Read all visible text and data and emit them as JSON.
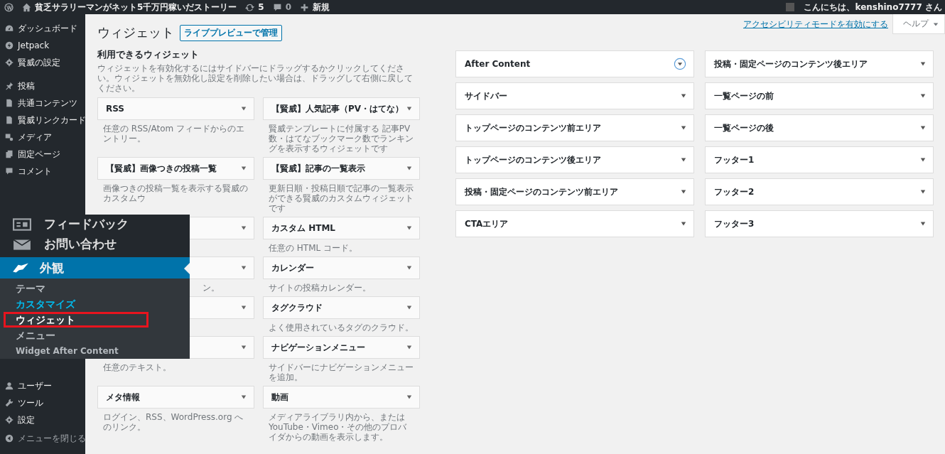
{
  "admin_bar": {
    "site_name": "貧乏サラリーマンがネット5千万円稼いだストーリー",
    "updates": "5",
    "comments": "0",
    "new": "新規",
    "greeting": "こんにちは、kenshino7777 さん"
  },
  "sidebar": {
    "groups": [
      [
        {
          "label": "ダッシュボード"
        },
        {
          "label": "Jetpack"
        },
        {
          "label": "賢威の設定"
        }
      ],
      [
        {
          "label": "投稿"
        },
        {
          "label": "共通コンテンツ"
        },
        {
          "label": "賢威リンクカード"
        },
        {
          "label": "メディア"
        },
        {
          "label": "固定ページ"
        },
        {
          "label": "コメント"
        }
      ]
    ],
    "bottom_items": [
      {
        "label": "ユーザー"
      },
      {
        "label": "ツール"
      },
      {
        "label": "設定"
      }
    ],
    "collapse": "メニューを閉じる"
  },
  "overlay": {
    "items": [
      {
        "label": "フィードバック"
      },
      {
        "label": "お問い合わせ"
      }
    ],
    "current": {
      "label": "外観"
    },
    "submenu": [
      {
        "label": "テーマ",
        "selected": false,
        "focused": false,
        "highlighted": false
      },
      {
        "label": "カスタマイズ",
        "selected": false,
        "focused": true,
        "highlighted": false
      },
      {
        "label": "ウィジェット",
        "selected": true,
        "focused": false,
        "highlighted": true
      },
      {
        "label": "メニュー",
        "selected": false,
        "focused": false,
        "highlighted": false
      },
      {
        "label": "Widget After Content",
        "selected": false,
        "focused": false,
        "highlighted": false
      }
    ]
  },
  "page": {
    "title": "ウィジェット",
    "live_preview": "ライブプレビューで管理",
    "accessibility_link": "アクセシビリティモードを有効にする",
    "help": "ヘルプ"
  },
  "available": {
    "title": "利用できるウィジェット",
    "description": "ウィジェットを有効化するにはサイドバーにドラッグするかクリックしてください。ウィジェットを無効化し設定を削除したい場合は、ドラッグして右側に戻してください。",
    "widgets": [
      {
        "kind": "widget",
        "title": "RSS",
        "description": "任意の RSS/Atom フィードからのエントリー。"
      },
      {
        "kind": "widget",
        "title": "【賢威】人気記事（PV・はてな）",
        "description": "賢威テンプレートに付属する 記事PV数・はてなブックマーク数でランキングを表示するウィジェットです"
      },
      {
        "kind": "widget",
        "title": "【賢威】画像つきの投稿一覧",
        "description": "画像つきの投稿一覧を表示する賢威のカスタムウ"
      },
      {
        "kind": "widget",
        "title": "【賢威】記事の一覧表示",
        "description": "更新日順・投稿日順で記事の一覧表示ができる賢威のカスタムウィジェットです"
      },
      {
        "kind": "covered"
      },
      {
        "kind": "widget",
        "title": "カスタム HTML",
        "description": "任意の HTML コード。"
      },
      {
        "kind": "covered",
        "description_tail": "ン。"
      },
      {
        "kind": "widget",
        "title": "カレンダー",
        "description": "サイトの投稿カレンダー。"
      },
      {
        "kind": "covered"
      },
      {
        "kind": "widget",
        "title": "タグクラウド",
        "description": "よく使用されているタグのクラウド。"
      },
      {
        "kind": "covered",
        "description": "任意のテキスト。"
      },
      {
        "kind": "widget",
        "title": "ナビゲーションメニュー",
        "description": "サイドバーにナビゲーションメニューを追加。"
      },
      {
        "kind": "widget",
        "title": "メタ情報",
        "description": "ログイン、RSS、WordPress.org へのリンク。"
      },
      {
        "kind": "widget",
        "title": "動画",
        "description": "メディアライブラリ内から、または YouTube・Vimeo・その他のプロバイダからの動画を表示します。"
      }
    ]
  },
  "areas": [
    [
      {
        "name": "After Content",
        "focused": true
      },
      {
        "name": "サイドバー",
        "focused": false
      },
      {
        "name": "トップページのコンテンツ前エリア",
        "focused": false
      },
      {
        "name": "トップページのコンテンツ後エリア",
        "focused": false
      },
      {
        "name": "投稿・固定ページのコンテンツ前エリア",
        "focused": false
      },
      {
        "name": "CTAエリア",
        "focused": false
      }
    ],
    [
      {
        "name": "投稿・固定ページのコンテンツ後エリア",
        "focused": false
      },
      {
        "name": "一覧ページの前",
        "focused": false
      },
      {
        "name": "一覧ページの後",
        "focused": false
      },
      {
        "name": "フッター1",
        "focused": false
      },
      {
        "name": "フッター2",
        "focused": false
      },
      {
        "name": "フッター3",
        "focused": false
      }
    ]
  ]
}
